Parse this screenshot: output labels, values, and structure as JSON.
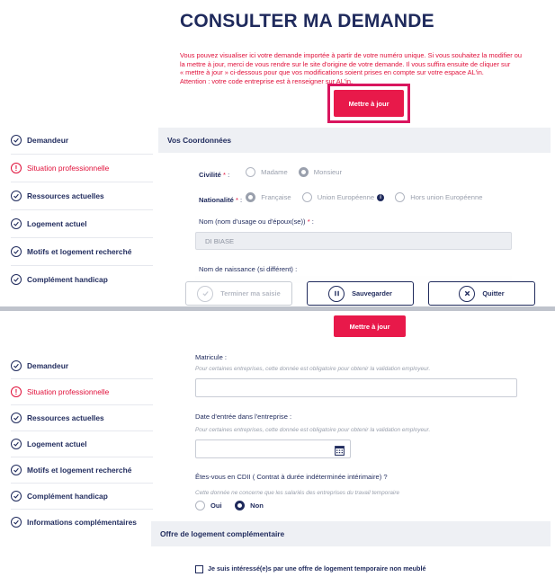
{
  "header": {
    "title": "CONSULTER MA DEMANDE",
    "intro_lines": [
      "Vous pouvez visualiser ici votre demande importée à partir de votre numéro unique. Si vous souhaitez la modifier ou",
      "la mettre à jour, merci de vous rendre sur le site d'origine de votre demande. Il vous suffira ensuite de cliquer sur",
      "« mettre à jour » ci-dessous pour que vos modifications soient prises en compte sur votre espace AL'in.",
      "Attention : votre code entreprise est à renseigner sur AL'in."
    ],
    "update_label": "Mettre à jour"
  },
  "sidebar_top": {
    "items": [
      {
        "label": "Demandeur",
        "state": "done"
      },
      {
        "label": "Situation professionnelle",
        "state": "error"
      },
      {
        "label": "Ressources actuelles",
        "state": "done"
      },
      {
        "label": "Logement actuel",
        "state": "done"
      },
      {
        "label": "Motifs et logement recherché",
        "state": "done"
      },
      {
        "label": "Complément handicap",
        "state": "done"
      }
    ]
  },
  "form_top": {
    "section_title": "Vos Coordonnées",
    "civilite_label": "Civilité",
    "civilite_options": [
      "Madame",
      "Monsieur"
    ],
    "nationalite_label": "Nationalité",
    "nationalite_options": [
      "Française",
      "Union Européenne",
      "Hors union Européenne"
    ],
    "nom_label": "Nom (nom d'usage ou d'époux(se))",
    "nom_value": "DI BIASE",
    "naissance_label": "Nom de naissance (si différent) :"
  },
  "footer": {
    "terminer_label": "Terminer ma saisie",
    "sauvegarder_label": "Sauvegarder",
    "quitter_label": "Quitter"
  },
  "second": {
    "update_label": "Mettre à jour",
    "sidebar_items": [
      {
        "label": "Demandeur",
        "state": "done"
      },
      {
        "label": "Situation professionnelle",
        "state": "error"
      },
      {
        "label": "Ressources actuelles",
        "state": "done"
      },
      {
        "label": "Logement actuel",
        "state": "done"
      },
      {
        "label": "Motifs et logement recherché",
        "state": "done"
      },
      {
        "label": "Complément handicap",
        "state": "done"
      },
      {
        "label": "Informations complémentaires",
        "state": "done"
      }
    ],
    "matricule_label": "Matricule :",
    "matricule_hint": "Pour certaines entreprises, cette donnée est obligatoire pour obtenir la validation employeur.",
    "date_label": "Date d'entrée dans l'entreprise :",
    "date_hint": "Pour certaines entreprises, cette donnée est obligatoire pour obtenir la validation employeur.",
    "cdii_label": "Êtes-vous en CDII ( Contrat à durée indéterminée intérimaire) ?",
    "cdii_hint": "Cette donnée ne concerne que les salariés des entreprises du travail temporaire",
    "cdii_options": [
      "Oui",
      "Non"
    ],
    "offre_title": "Offre de logement complémentaire",
    "checkbox_label": "Je suis intéressé(e)s par une offre de logement temporaire non meublé"
  }
}
